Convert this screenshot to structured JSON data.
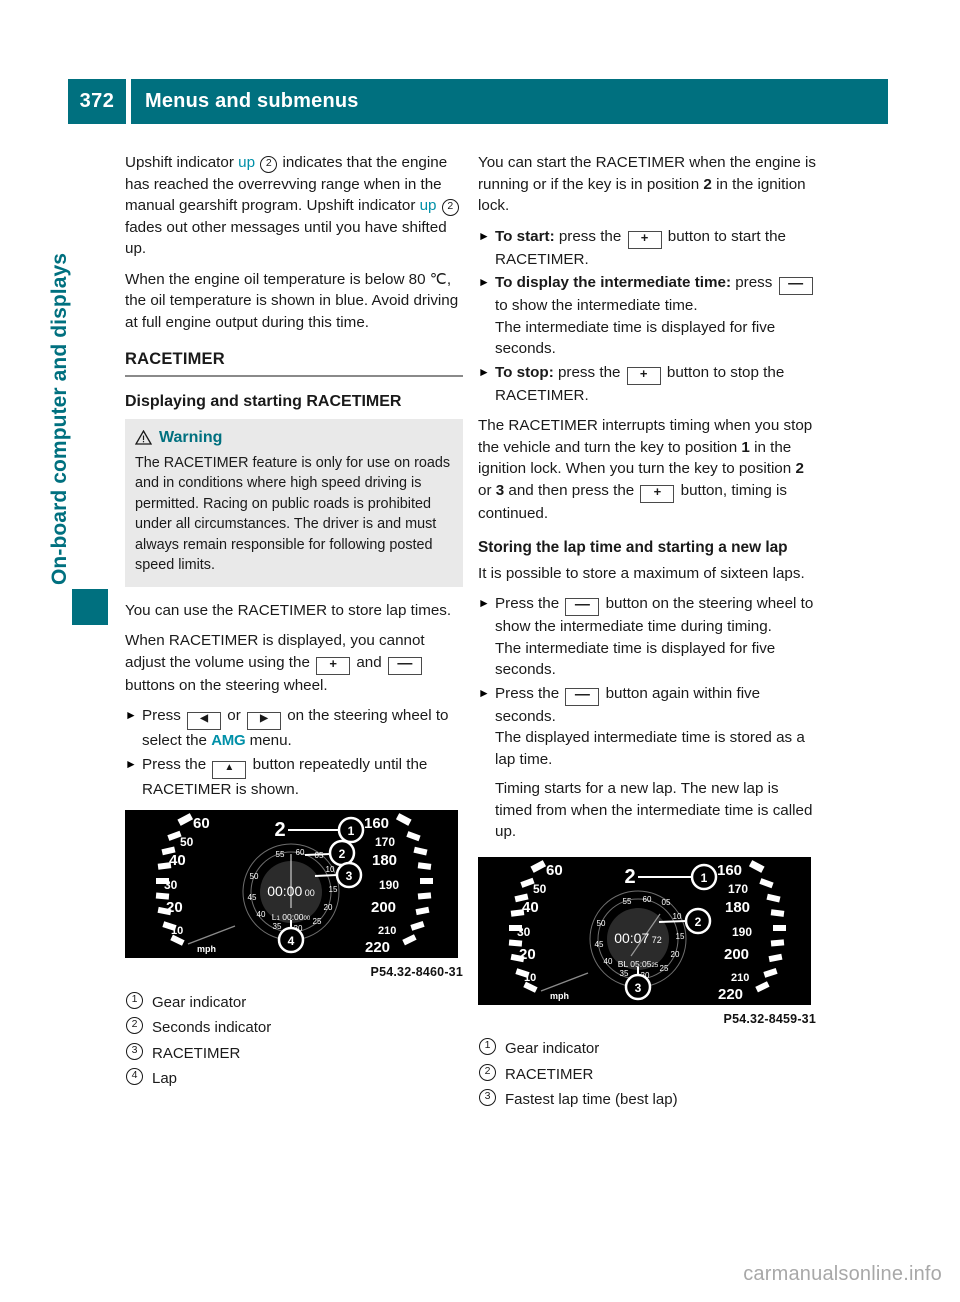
{
  "header": {
    "page_number": "372",
    "title": "Menus and submenus",
    "accent_color": "#00707f"
  },
  "side_tab": {
    "label": "On-board computer and displays"
  },
  "left_column": {
    "para1_a": "Upshift indicator ",
    "para1_up": "up",
    "para1_ref": "2",
    "para1_b": " indicates that the engine has reached the overrevving range when in the manual gearshift program. Upshift indicator ",
    "para1_up2": "up",
    "para1_ref2": "2",
    "para1_c": " fades out other messages until you have shifted up.",
    "para2": "When the engine oil temperature is below 80 ℃, the oil temperature is shown in blue. Avoid driving at full engine output during this time.",
    "section_heading": "RACETIMER",
    "sub_heading": "Displaying and starting RACETIMER",
    "warning": {
      "label": "Warning",
      "body": "The RACETIMER feature is only for use on roads and in conditions where high speed driving is permitted. Racing on public roads is prohibited under all circumstances. The driver is and must always remain responsible for following posted speed limits."
    },
    "para3": "You can use the RACETIMER to store lap times.",
    "para4_a": "When RACETIMER is displayed, you cannot adjust the volume using the ",
    "para4_key1": "+",
    "para4_mid": " and ",
    "para4_key2": "—",
    "para4_b": " buttons on the steering wheel.",
    "action1_a": "Press ",
    "action1_key1": "◀",
    "action1_mid": " or ",
    "action1_key2": "▶",
    "action1_b": " on the steering wheel to select the ",
    "action1_amg": "AMG",
    "action1_c": " menu.",
    "action2_a": "Press the ",
    "action2_key": "▲",
    "action2_b": " button repeatedly until the RACETIMER is shown.",
    "figure": {
      "code": "P54.32-8460-31",
      "gear": "2",
      "timer": "00:00",
      "timer_small": "00",
      "lap_label": "L",
      "lap_sub": "1",
      "lap_time": "00:00",
      "lap_time_small": "00",
      "unit": "mph",
      "left_scale": [
        "60",
        "50",
        "40",
        "30",
        "20",
        "10"
      ],
      "right_scale": [
        "160",
        "170",
        "180",
        "190",
        "200",
        "210",
        "220"
      ],
      "dial_ticks": [
        "55",
        "60",
        "05",
        "10",
        "15",
        "20",
        "25",
        "30",
        "35",
        "40",
        "45",
        "50"
      ],
      "callouts": [
        "1",
        "2",
        "3",
        "4"
      ]
    },
    "legend": [
      {
        "num": "1",
        "text": "Gear indicator"
      },
      {
        "num": "2",
        "text": "Seconds indicator"
      },
      {
        "num": "3",
        "text": "RACETIMER"
      },
      {
        "num": "4",
        "text": "Lap"
      }
    ]
  },
  "right_column": {
    "para1": "You can start the RACETIMER when the engine is running or if the key is in position",
    "para1_bold": "2",
    "para1_end": "in the ignition lock.",
    "action1_label": "To start:",
    "action1_a": " press the ",
    "action1_key": "+",
    "action1_b": " button to start the RACETIMER.",
    "action2_label": "To display the intermediate time:",
    "action2_a": " press ",
    "action2_key": "—",
    "action2_b": " to show the intermediate time.",
    "action2_note": "The intermediate time is displayed for five seconds.",
    "action3_label": "To stop:",
    "action3_a": " press the ",
    "action3_key": "+",
    "action3_b": " button to stop the RACETIMER.",
    "para2_a": "The RACETIMER interrupts timing when you stop the vehicle and turn the key to position ",
    "para2_b1": "1",
    "para2_b": " in the ignition lock. When you turn the key to position ",
    "para2_b2": "2",
    "para2_c": " or ",
    "para2_b3": "3",
    "para2_d": " and then press the ",
    "para2_key": "+",
    "para2_e": " button, timing is continued.",
    "sub_heading": "Storing the lap time and starting a new lap",
    "para3": "It is possible to store a maximum of sixteen laps.",
    "action4_a": "Press the ",
    "action4_key": "—",
    "action4_b": " button on the steering wheel to show the intermediate time during timing.",
    "action4_note": "The intermediate time is displayed for five seconds.",
    "action5_a": "Press the ",
    "action5_key": "—",
    "action5_b": " button again within five seconds.",
    "action5_note": "The displayed intermediate time is stored as a lap time.",
    "action5_note2": "Timing starts for a new lap. The new lap is timed from when the intermediate time is called up.",
    "figure": {
      "code": "P54.32-8459-31",
      "gear": "2",
      "timer": "00:07",
      "timer_small": "72",
      "best_label": "BL",
      "best_time": "05:05",
      "best_time_small": "25",
      "unit": "mph",
      "left_scale": [
        "60",
        "50",
        "40",
        "30",
        "20",
        "10"
      ],
      "right_scale": [
        "160",
        "170",
        "180",
        "190",
        "200",
        "210",
        "220"
      ],
      "dial_ticks": [
        "55",
        "60",
        "05",
        "10",
        "15",
        "20",
        "25",
        "30",
        "35",
        "40",
        "45",
        "50"
      ],
      "callouts": [
        "1",
        "2",
        "3"
      ]
    },
    "legend": [
      {
        "num": "1",
        "text": "Gear indicator"
      },
      {
        "num": "2",
        "text": "RACETIMER"
      },
      {
        "num": "3",
        "text": "Fastest lap time (best lap)"
      }
    ]
  },
  "footer": {
    "watermark": "carmanualsonline.info"
  }
}
